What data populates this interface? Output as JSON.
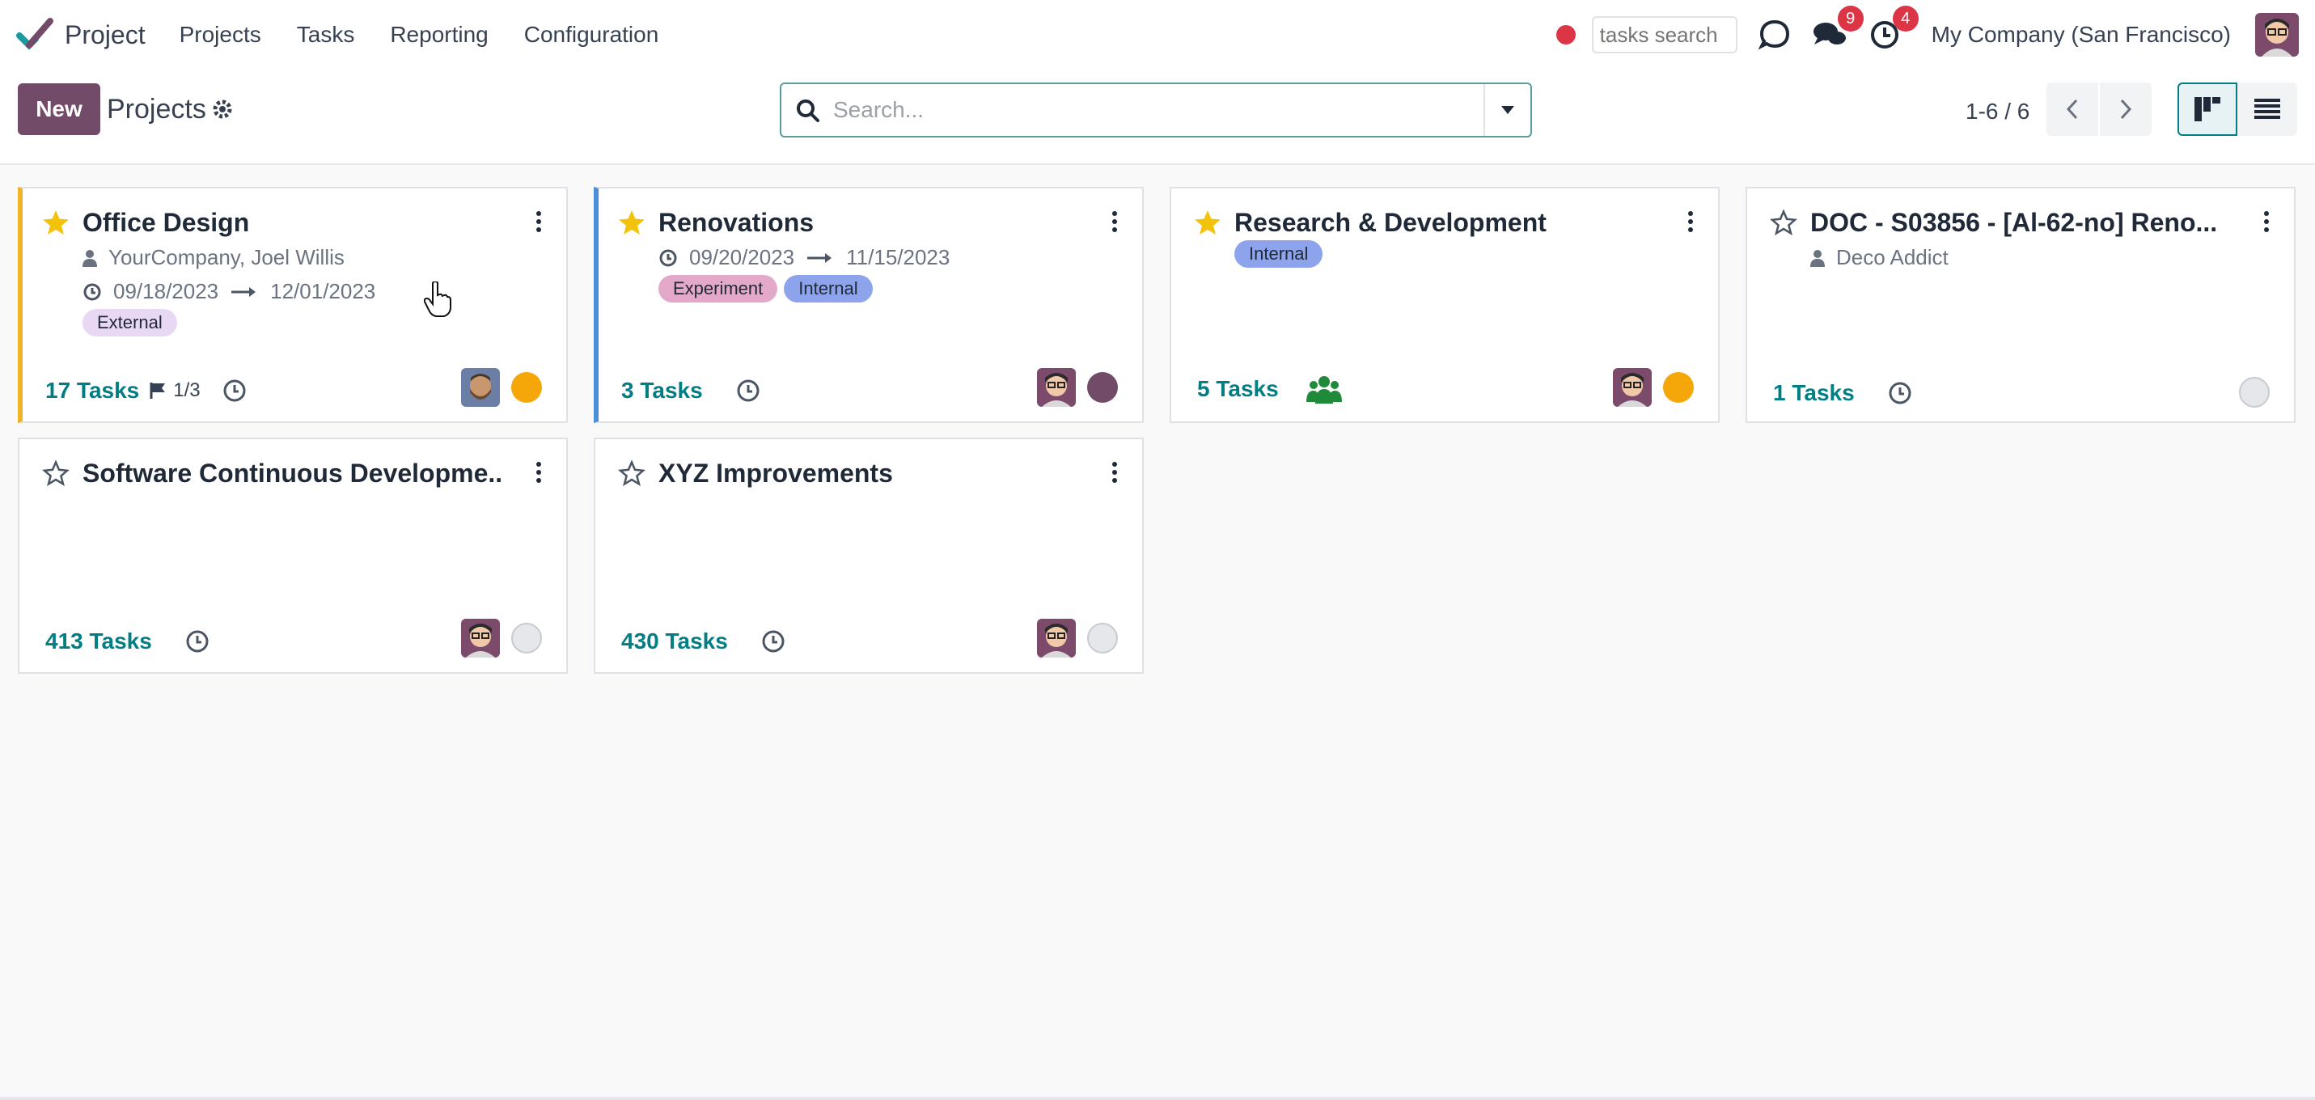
{
  "navbar": {
    "app_name": "Project",
    "menu": [
      "Projects",
      "Tasks",
      "Reporting",
      "Configuration"
    ],
    "tasks_search_placeholder": "tasks search",
    "messages_badge": "9",
    "activities_badge": "4",
    "company": "My Company (San Francisco)"
  },
  "control_panel": {
    "new_label": "New",
    "breadcrumb": "Projects",
    "search_placeholder": "Search...",
    "pager": "1-6 / 6"
  },
  "cards": [
    {
      "title": "Office Design",
      "starred": true,
      "customer": "YourCompany, Joel Willis",
      "date_start": "09/18/2023",
      "date_end": "12/01/2023",
      "tags": [
        "External"
      ],
      "tasks_label": "17 Tasks",
      "milestones": "1/3",
      "status_color": "#f5a70a",
      "accent_color": "#f0b429"
    },
    {
      "title": "Renovations",
      "starred": true,
      "date_start": "09/20/2023",
      "date_end": "11/15/2023",
      "tags": [
        "Experiment",
        "Internal"
      ],
      "tasks_label": "3 Tasks",
      "status_color": "#714b67",
      "accent_color": "#4a90d9"
    },
    {
      "title": "Research & Development",
      "starred": true,
      "tags": [
        "Internal"
      ],
      "tasks_label": "5 Tasks",
      "status_color": "#f5a70a"
    },
    {
      "title": "DOC - S03856 - [Al-62-no] Reno...",
      "starred": false,
      "customer": "Deco Addict",
      "tasks_label": "1 Tasks",
      "status_color": "#e5e7eb"
    },
    {
      "title": "Software Continuous Developme...",
      "starred": false,
      "tasks_label": "413 Tasks",
      "status_color": "#e5e7eb"
    },
    {
      "title": "XYZ Improvements",
      "starred": false,
      "tasks_label": "430 Tasks",
      "status_color": "#e5e7eb"
    }
  ],
  "colors": {
    "brand_primary": "#714b67",
    "accent_teal": "#017e84",
    "star_gold": "#f3c30b",
    "badge_red": "#dc3545"
  },
  "icons": {
    "brand": "checkmark-logo-icon",
    "gear": "gear-icon",
    "search": "search-icon",
    "kebab": "kebab-menu-icon",
    "star": "star-icon",
    "clock": "clock-icon",
    "person": "person-icon",
    "flag": "flag-icon",
    "followers": "users-group-icon"
  }
}
